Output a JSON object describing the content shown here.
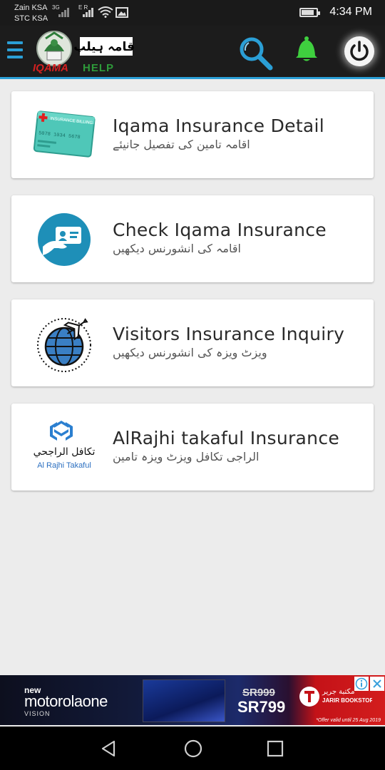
{
  "status_bar": {
    "carrier_1": "Zain KSA",
    "carrier_2": "STC KSA",
    "network_1": "3G",
    "network_2": "E R",
    "time": "4:34 PM",
    "battery_level": 0.85
  },
  "app_bar": {
    "logo_urdu": "اقامہ ہیلپ",
    "logo_text_1": "IQAMA",
    "logo_text_2": "HELP",
    "accent_color": "#2b9fd6"
  },
  "cards": [
    {
      "title": "Iqama Insurance Detail",
      "subtitle": "اقامہ تامین کی تفصیل جانیئے",
      "icon": "insurance-card-icon"
    },
    {
      "title": "Check Iqama Insurance",
      "subtitle": "اقامہ کی انشورنس دیکھیں",
      "icon": "id-card-hand-icon"
    },
    {
      "title": "Visitors Insurance Inquiry",
      "subtitle": "ویزٹ ویزہ کی انشورنس دیکھیں",
      "icon": "globe-plane-icon"
    },
    {
      "title": "AlRajhi takaful Insurance",
      "subtitle": "الراجی تکافل ویزٹ ویزہ تامین",
      "icon": "alrajhi-takaful-logo",
      "logo_arabic": "تكافل الراجحي",
      "logo_latin": "Al Rajhi Takaful"
    }
  ],
  "ad_banner": {
    "new_label": "new",
    "brand": "motorolaone",
    "brand_sub": "VISION",
    "old_price": "SR999",
    "price": "SR799",
    "store_arabic": "مكتبة جرير",
    "store": "JARIR BOOKSTORE",
    "offer_note": "*Offer valid until 25 Aug 2019"
  },
  "card_card_label": "INSURANCE BILLING",
  "card_card_number": "5078 1034 5678"
}
